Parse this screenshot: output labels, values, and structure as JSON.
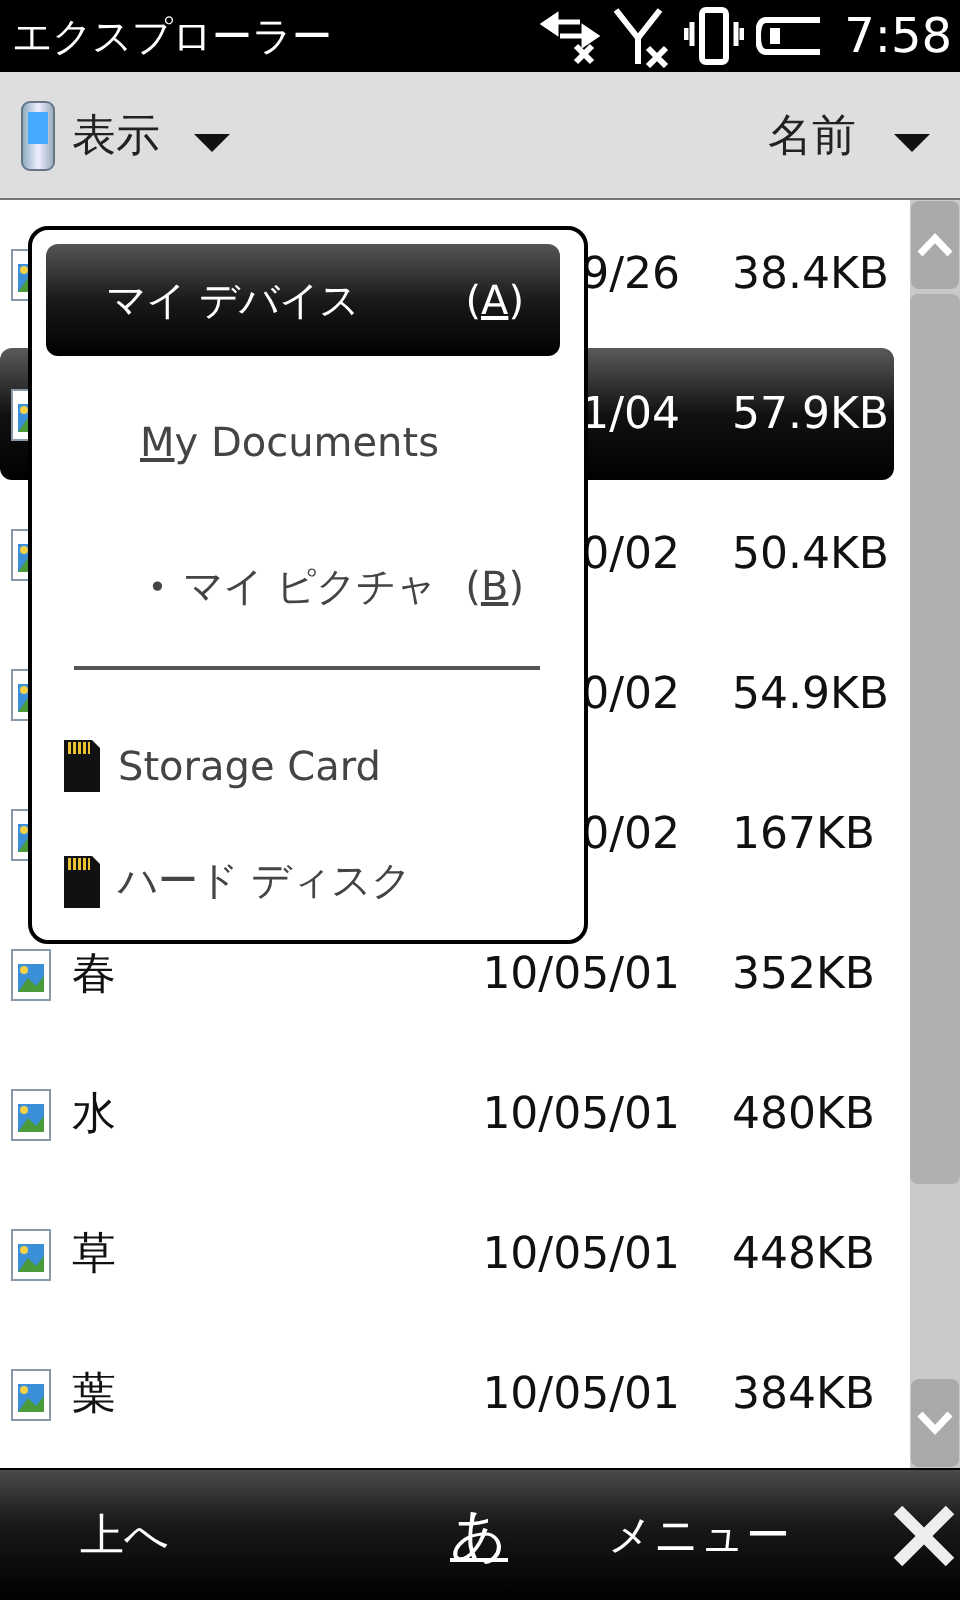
{
  "status_bar": {
    "title": "エクスプローラー",
    "time": "7:58"
  },
  "toolbar": {
    "view_label": "表示",
    "sort_label": "名前"
  },
  "files": [
    {
      "date": "9/26",
      "size": "38.4KB",
      "selected": false
    },
    {
      "date": "1/04",
      "size": "57.9KB",
      "selected": true
    },
    {
      "date": "0/02",
      "size": "50.4KB",
      "selected": false
    },
    {
      "date": "0/02",
      "size": "54.9KB",
      "selected": false
    },
    {
      "date": "0/02",
      "size": "167KB",
      "selected": false
    },
    {
      "name": "春",
      "date": "10/05/01",
      "size": "352KB",
      "selected": false
    },
    {
      "name": "水",
      "date": "10/05/01",
      "size": "480KB",
      "selected": false
    },
    {
      "name": "草",
      "date": "10/05/01",
      "size": "448KB",
      "selected": false
    },
    {
      "name": "葉",
      "date": "10/05/01",
      "size": "384KB",
      "selected": false
    }
  ],
  "location_menu": {
    "items": [
      {
        "kind": "folder",
        "label": "マイ デバイス",
        "shortcut": "(A)",
        "shortcut_underlined": true,
        "selected": true
      },
      {
        "kind": "folder",
        "label": "My Documents",
        "underline_first": true,
        "selected": false
      },
      {
        "kind": "subfolder",
        "marker": "•",
        "label": "マイ ピクチャ",
        "shortcut": "(B)",
        "shortcut_underlined": true,
        "selected": false
      },
      {
        "kind": "separator"
      },
      {
        "kind": "storage",
        "label": "Storage Card",
        "selected": false
      },
      {
        "kind": "storage",
        "label": "ハード ディスク",
        "selected": false
      }
    ]
  },
  "bottom_bar": {
    "left": "上へ",
    "input_mode": "あ",
    "menu": "メニュー"
  }
}
